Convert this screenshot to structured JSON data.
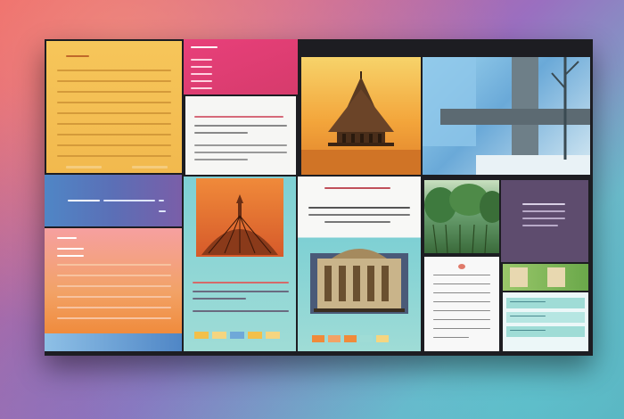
{
  "scene": "collage",
  "colors": {
    "board": "#1d1d22",
    "yellow": "#f6c65a",
    "pink": "#e8407a",
    "orange": "#f08a3a",
    "teal": "#7ed0d4",
    "purple": "#5e4c6e",
    "blue": "#4f86c6"
  },
  "icons": [
    "pagoda-icon",
    "tower-icon",
    "tree-icon",
    "museum-icon"
  ]
}
